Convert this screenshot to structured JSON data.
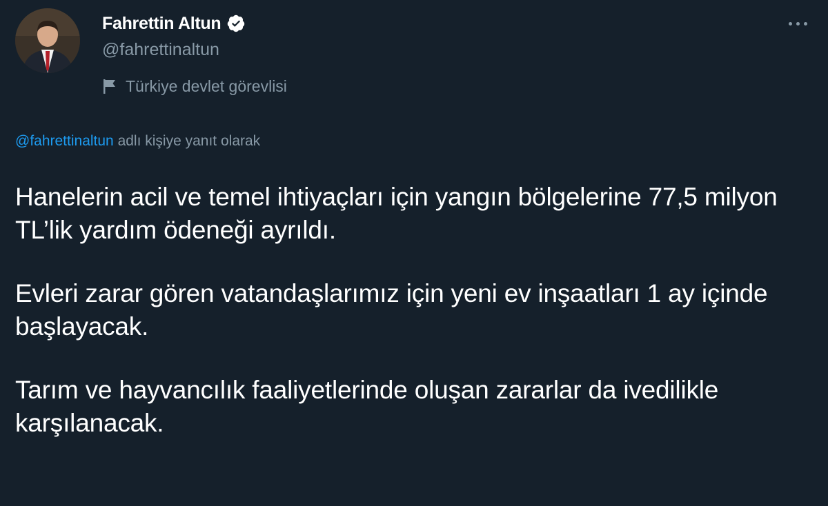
{
  "author": {
    "display_name": "Fahrettin Altun",
    "handle": "@fahrettinaltun",
    "affiliation": "Türkiye devlet görevlisi",
    "verified": true,
    "avatar_icon": "user-avatar",
    "affiliation_icon": "flag-icon"
  },
  "reply": {
    "mention": "@fahrettinaltun",
    "suffix": " adlı kişiye yanıt olarak"
  },
  "tweet": {
    "paragraphs": [
      "Hanelerin acil ve temel ihtiyaçları için yangın bölgelerine 77,5 milyon TL’lik yardım ödeneği ayrıldı.",
      "Evleri zarar gören vatandaşlarımız için yeni ev inşaatları 1 ay içinde başlayacak.",
      "Tarım ve hayvancılık faaliyetlerinde oluşan zararlar da ivedilikle karşılanacak."
    ]
  },
  "colors": {
    "background": "#15202b",
    "text_primary": "#ffffff",
    "text_secondary": "#8899a6",
    "link": "#1d9bf0"
  }
}
